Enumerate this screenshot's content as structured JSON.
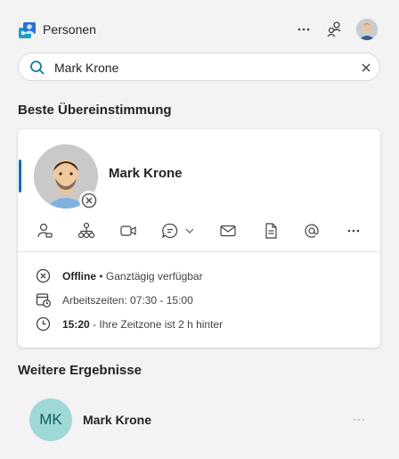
{
  "app": {
    "title": "Personen"
  },
  "search": {
    "value": "Mark Krone",
    "placeholder": ""
  },
  "sections": {
    "best_match": "Beste Übereinstimmung",
    "more_results": "Weitere Ergebnisse"
  },
  "card": {
    "name": "Mark Krone",
    "status_bold": "Offline",
    "status_rest": " • Ganztägig verfügbar",
    "work_hours": "Arbeitszeiten: 07:30 - 15:00",
    "time_bold": "15:20",
    "time_rest": " - Ihre Zeitzone ist 2 h hinter",
    "actions": [
      "contact-card-icon",
      "org-chart-icon",
      "video-call-icon",
      "chat-icon",
      "mail-icon",
      "document-icon",
      "mention-icon",
      "more-icon"
    ]
  },
  "results": [
    {
      "initials": "MK",
      "name": "Mark Krone"
    }
  ],
  "colors": {
    "accent": "#0f6cbd",
    "search_icon": "#0f7b9e",
    "initials_bg": "#9fd9d6",
    "initials_fg": "#0d5d5a"
  }
}
